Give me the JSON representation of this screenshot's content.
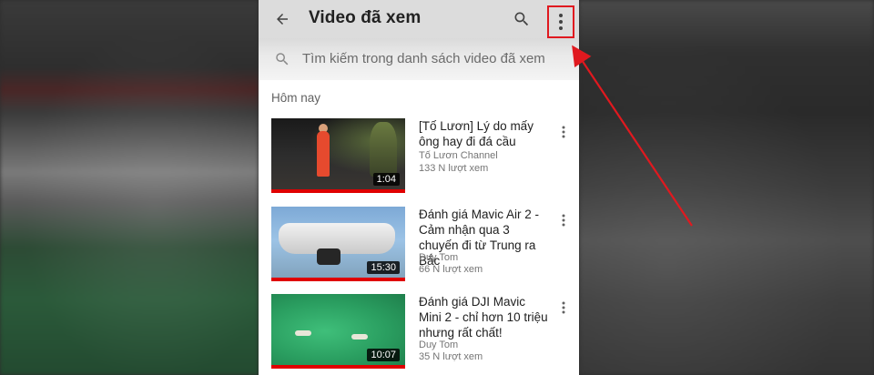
{
  "header": {
    "title": "Video đã xem"
  },
  "search": {
    "placeholder": "Tìm kiếm trong danh sách video đã xem"
  },
  "section": {
    "label": "Hôm nay"
  },
  "videos": [
    {
      "title": "[Tố Lươn] Lý do mấy ông hay đi đá cầu",
      "channel": "Tố Lươn Channel",
      "views": "133 N lượt xem",
      "duration": "1:04",
      "watched_progress": 1.0
    },
    {
      "title": "Đánh giá Mavic Air 2 - Cảm nhận qua 3 chuyến đi từ Trung ra Bắc",
      "channel": "Duy Tom",
      "views": "66 N lượt xem",
      "duration": "15:30",
      "watched_progress": 1.0
    },
    {
      "title": "Đánh giá DJI Mavic Mini 2 - chỉ hơn 10 triệu nhưng rất chất!",
      "channel": "Duy Tom",
      "views": "35 N lượt xem",
      "duration": "10:07",
      "watched_progress": 1.0
    }
  ],
  "icons": {
    "back": "arrow-back-icon",
    "search": "search-icon",
    "more": "more-vert-icon"
  },
  "colors": {
    "accent_red": "#e00000",
    "highlight_box": "#e0191f",
    "appbar_bg": "#dcdcdc"
  }
}
